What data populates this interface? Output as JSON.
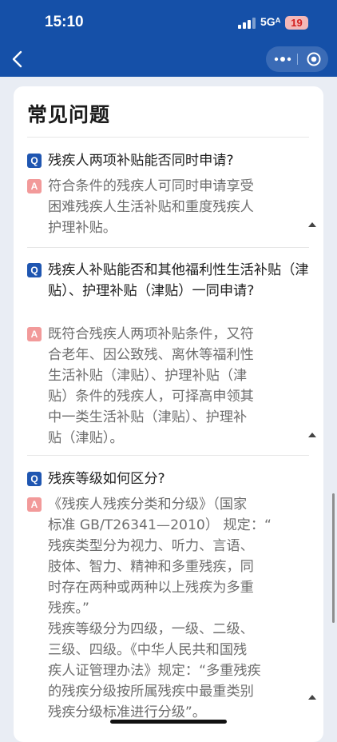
{
  "status_bar": {
    "time": "15:10",
    "network": "5Gᴬ",
    "battery": "19"
  },
  "nav": {
    "back_icon": "chevron-left-icon",
    "more_icon": "more-dots-icon",
    "close_icon": "target-circle-icon"
  },
  "page": {
    "title": "常见问题"
  },
  "faq": {
    "q_badge": "Q",
    "a_badge": "A",
    "items": [
      {
        "question": "残疾人两项补贴能否同时申请?",
        "answer": "符合条件的残疾人可同时申请享受\n困难残疾人生活补贴和重度残疾人\n护理补贴。"
      },
      {
        "question": "残疾人补贴能否和其他福利性生活补贴（津贴）、护理补贴（津贴）一同申请?",
        "answer": "既符合残疾人两项补贴条件，又符\n合老年、因公致残、离休等福利性\n生活补贴（津贴）、护理补贴（津\n贴）条件的残疾人，可择高申领其\n中一类生活补贴（津贴）、护理补\n贴（津贴）。"
      },
      {
        "question": "残疾等级如何区分?",
        "answer": "《残疾人残疾分类和分级》（国家\n标准 GB/T26341—2010） 规定：“\n残疾类型分为视力、听力、言语、\n肢体、智力、精神和多重残疾，同\n时存在两种或两种以上残疾为多重\n残疾。”\n残疾等级分为四级，一级、二级、\n三级、四级。《中华人民共和国残\n疾人证管理办法》规定：“多重残疾\n的残疾分级按所属残疾中最重类别\n残疾分级标准进行分级”。"
      }
    ]
  }
}
